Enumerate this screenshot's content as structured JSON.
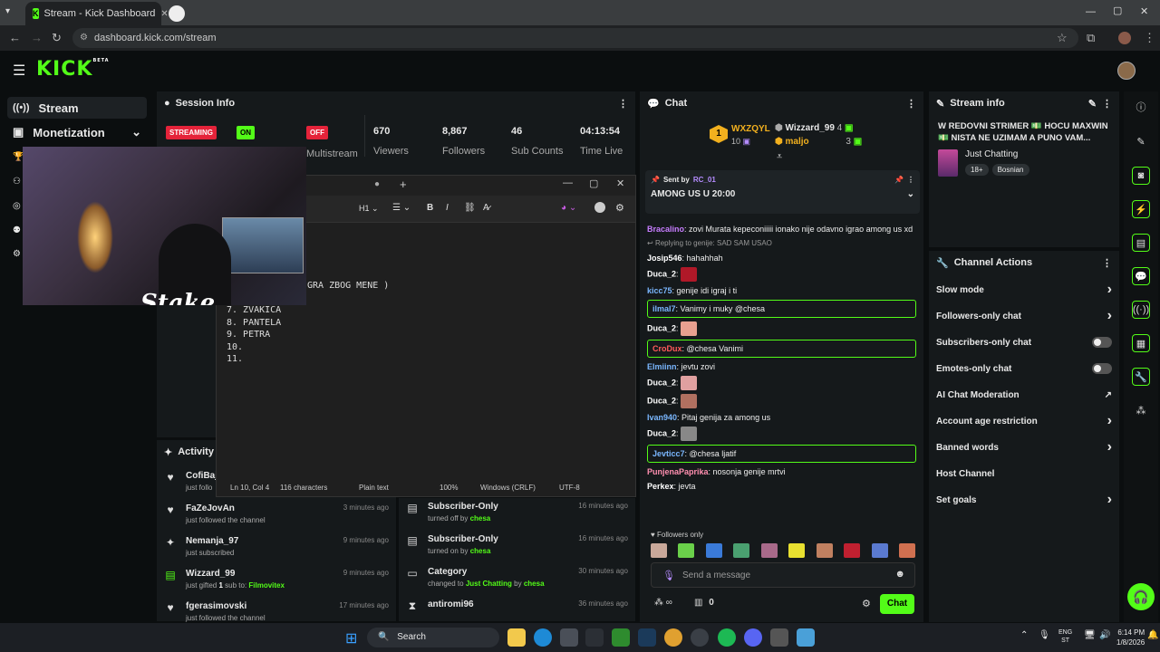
{
  "browser": {
    "tab_title": "Stream - Kick Dashboard",
    "url": "dashboard.kick.com/stream"
  },
  "header": {
    "logo": "KICK",
    "logo_sup": "BETA"
  },
  "sidebar": {
    "items": [
      {
        "label": "Stream"
      },
      {
        "label": "Monetization"
      }
    ]
  },
  "session": {
    "title": "Session Info",
    "streaming": "STREAMING",
    "on": "ON",
    "off": "OFF",
    "multistream": "Multistream",
    "stats": [
      {
        "n": "670",
        "l": "Viewers"
      },
      {
        "n": "8,867",
        "l": "Followers"
      },
      {
        "n": "46",
        "l": "Sub Counts"
      },
      {
        "n": "04:13:54",
        "l": "Time Live"
      }
    ]
  },
  "webcam": {
    "brand": "Stake"
  },
  "notepad": {
    "partial_text": "GRA ZBOG MENE )",
    "lines": [
      "7. ZVAKICA",
      "8. PANTELA",
      "9. PETRA",
      "10.",
      "11."
    ],
    "heading": "H1",
    "status": {
      "pos": "Ln 10, Col 4",
      "chars": "116 characters",
      "format": "Plain text",
      "zoom": "100%",
      "eol": "Windows (CRLF)",
      "enc": "UTF-8"
    }
  },
  "activity": {
    "title": "Activity Fe",
    "left": [
      {
        "name": "CofiBaj",
        "desc": "just follo",
        "time": ""
      },
      {
        "name": "FaZeJovAn",
        "desc": "just followed the channel",
        "time": "3 minutes ago"
      },
      {
        "name": "Nemanja_97",
        "desc": "just subscribed",
        "time": "9 minutes ago"
      },
      {
        "name": "Wizzard_99",
        "desc_a": "just gifted ",
        "desc_b": "1",
        "desc_c": " sub to: ",
        "desc_d": "Filmovitex",
        "time": "9 minutes ago"
      },
      {
        "name": "fgerasimovski",
        "desc": "just followed the channel",
        "time": "17 minutes ago"
      }
    ],
    "right": [
      {
        "name": "Subscriber-Only",
        "desc_a": "turned off by ",
        "desc_b": "chesa",
        "time": "16 minutes ago"
      },
      {
        "name": "Subscriber-Only",
        "desc_a": "turned on by ",
        "desc_b": "chesa",
        "time": "16 minutes ago"
      },
      {
        "name": "Category",
        "desc_a": "changed to ",
        "desc_b": "Just Chatting",
        "desc_c": " by ",
        "desc_d": "chesa",
        "time": "30 minutes ago"
      },
      {
        "name": "antiromi96",
        "desc": "",
        "time": "36 minutes ago"
      }
    ]
  },
  "chat": {
    "title": "Chat",
    "top1": "WXZQYL",
    "top1_n": "10",
    "top2": "Wizzard_99",
    "top2_n": "4",
    "top3": "maljo",
    "top3_n": "3",
    "pinned_by": "Sent by",
    "pinned_user": "RC_01",
    "pinned_msg": "AMONG US U 20:00",
    "messages": [
      {
        "user": "Bracalino",
        "color": "#c77dff",
        "text": "zovi Murata kepeconiiiii ionako nije odavno igrao among us xd"
      },
      {
        "reply": "Replying to genije: SAD SAM USAO"
      },
      {
        "user": "Josip546",
        "color": "#ffffff",
        "text": "hahahhah"
      },
      {
        "user": "Duca_2",
        "color": "#ffffff",
        "emote": true
      },
      {
        "user": "kicc75",
        "color": "#7ab7ff",
        "text": "genije idi igraj i ti"
      },
      {
        "user": "ilmal7",
        "color": "#7ab7ff",
        "text": "Vanimy i muky @chesa",
        "hl": true
      },
      {
        "user": "Duca_2",
        "color": "#ffffff",
        "emote": true
      },
      {
        "user": "CroDux",
        "color": "#ff5a5a",
        "text": "@chesa Vanimi",
        "hl": true
      },
      {
        "user": "Elmiinn",
        "color": "#7ab7ff",
        "text": "jevtu zovi"
      },
      {
        "user": "Duca_2",
        "color": "#ffffff",
        "emote": true
      },
      {
        "user": "Duca_2",
        "color": "#ffffff",
        "emote": true
      },
      {
        "user": "Ivan940",
        "color": "#7ab7ff",
        "text": "Pitaj genija za among us"
      },
      {
        "user": "Duca_2",
        "color": "#ffffff",
        "emote": true
      },
      {
        "user": "Jevticc7",
        "color": "#7ab7ff",
        "text": "@chesa ljatif",
        "hl": true
      },
      {
        "user": "PunjenaPaprika",
        "color": "#ff8fb0",
        "text": "nosonja genije mrtvi"
      },
      {
        "user": "Perkex",
        "color": "#ffffff",
        "text": "jevta"
      }
    ],
    "followers_only": "Followers only",
    "placeholder": "Send a message",
    "inf": "∞",
    "count": "0",
    "send": "Chat"
  },
  "stream_info": {
    "title": "Stream info",
    "stream_title": "W REDOVNI STRIMER 💵 HOCU MAXWIN 💵 NISTA NE UZIMAM A PUNO VAM...",
    "category": "Just Chatting",
    "tags": [
      "18+",
      "Bosnian"
    ]
  },
  "channel_actions": {
    "title": "Channel Actions",
    "items": [
      {
        "label": "Slow mode",
        "ctl": "chev"
      },
      {
        "label": "Followers-only chat",
        "ctl": "chev"
      },
      {
        "label": "Subscribers-only chat",
        "ctl": "toggle"
      },
      {
        "label": "Emotes-only chat",
        "ctl": "toggle"
      },
      {
        "label": "AI Chat Moderation",
        "ctl": "ext"
      },
      {
        "label": "Account age restriction",
        "ctl": "chev"
      },
      {
        "label": "Banned words",
        "ctl": "chev"
      },
      {
        "label": "Host Channel",
        "ctl": ""
      },
      {
        "label": "Set goals",
        "ctl": "chev"
      }
    ]
  },
  "taskbar": {
    "search": "Search",
    "lang1": "ENG",
    "lang2": "ST",
    "time": "6:14 PM",
    "date": "1/8/2026"
  },
  "colors": {
    "accent": "#53fc18",
    "streaming": "#e5233a"
  }
}
